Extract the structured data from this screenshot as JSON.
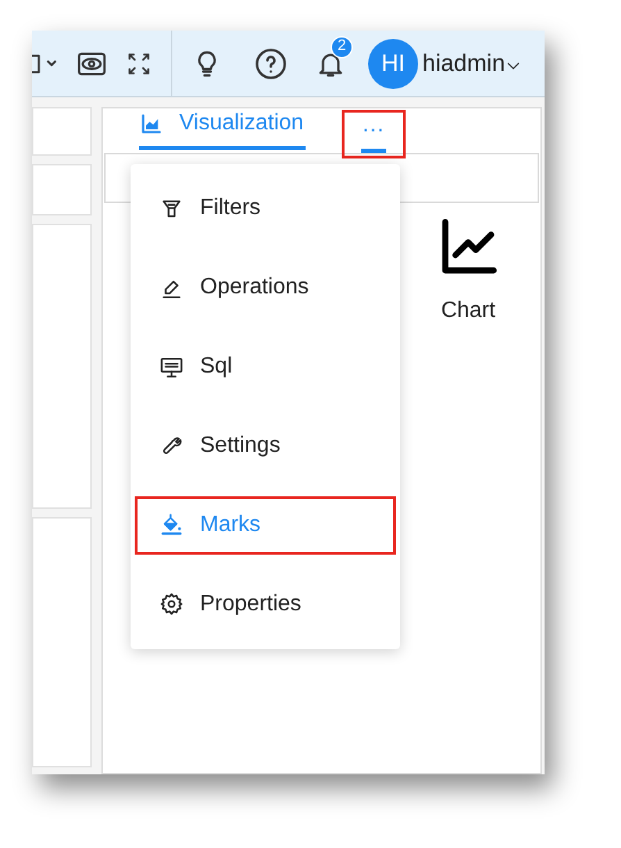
{
  "toolbar": {
    "notification_count": "2",
    "avatar_initials": "HI",
    "username": "hiadmin"
  },
  "tabs": [
    {
      "label": "Visualization",
      "kind": "chart",
      "selected": true,
      "highlighted": false
    },
    {
      "label": "···",
      "kind": "more",
      "selected": true,
      "highlighted": true
    }
  ],
  "chart_type": {
    "label": "Chart"
  },
  "menu": [
    {
      "label": "Filters",
      "kind": "filter",
      "selected": false,
      "highlighted": false
    },
    {
      "label": "Operations",
      "kind": "pen",
      "selected": false,
      "highlighted": false
    },
    {
      "label": "Sql",
      "kind": "sql",
      "selected": false,
      "highlighted": false
    },
    {
      "label": "Settings",
      "kind": "wrench",
      "selected": false,
      "highlighted": false
    },
    {
      "label": "Marks",
      "kind": "bucket",
      "selected": true,
      "highlighted": true
    },
    {
      "label": "Properties",
      "kind": "gear",
      "selected": false,
      "highlighted": false
    }
  ]
}
